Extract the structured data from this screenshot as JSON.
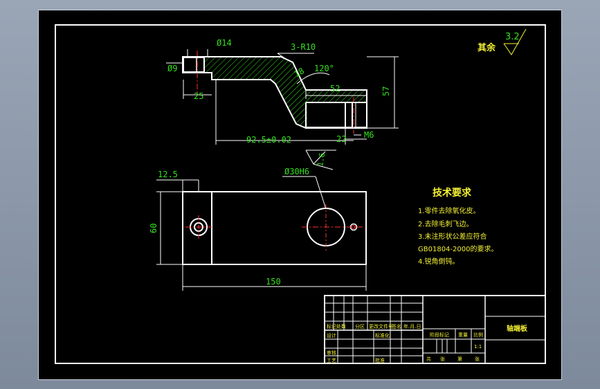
{
  "roughness": {
    "other_label": "其余",
    "value": "3.2"
  },
  "front_view": {
    "dim_d14": "Ø14",
    "dim_d9": "Ø9",
    "dim_3r10": "3-R10",
    "dim_120": "120°",
    "dim_18": "18",
    "dim_25": "25",
    "dim_52": "52",
    "dim_57": "57",
    "dim_92_5": "92.5±0.02",
    "dim_22": "22",
    "dim_m6": "M6",
    "roughness_1_6": "1.6"
  },
  "top_view": {
    "dim_d30h6": "Ø30H6",
    "dim_12_5": "12.5",
    "dim_60": "60",
    "dim_150": "150"
  },
  "tech_req": {
    "title": "技术要求",
    "items": [
      "1.零件去除氧化皮。",
      "2.去除毛刺飞边。",
      "3.未注形状公差应符合",
      "GB01804-2000的要求。",
      "4.锐角倒钝。"
    ]
  },
  "title_block": {
    "part_name": "轴端板",
    "h_mark": "标记",
    "h_count": "处数",
    "h_zone": "分区",
    "h_docno": "更改文件号",
    "h_sign": "签名",
    "h_date": "年.月.日",
    "designer": "设计",
    "standardize": "标准化",
    "review": "审核",
    "process": "工艺",
    "approve": "批准",
    "stage_mark": "阶段标记",
    "weight": "重量",
    "scale": "比例",
    "scale_value": "1:1",
    "total": "共",
    "sheets": "张",
    "page": "第",
    "sheet": "张"
  }
}
